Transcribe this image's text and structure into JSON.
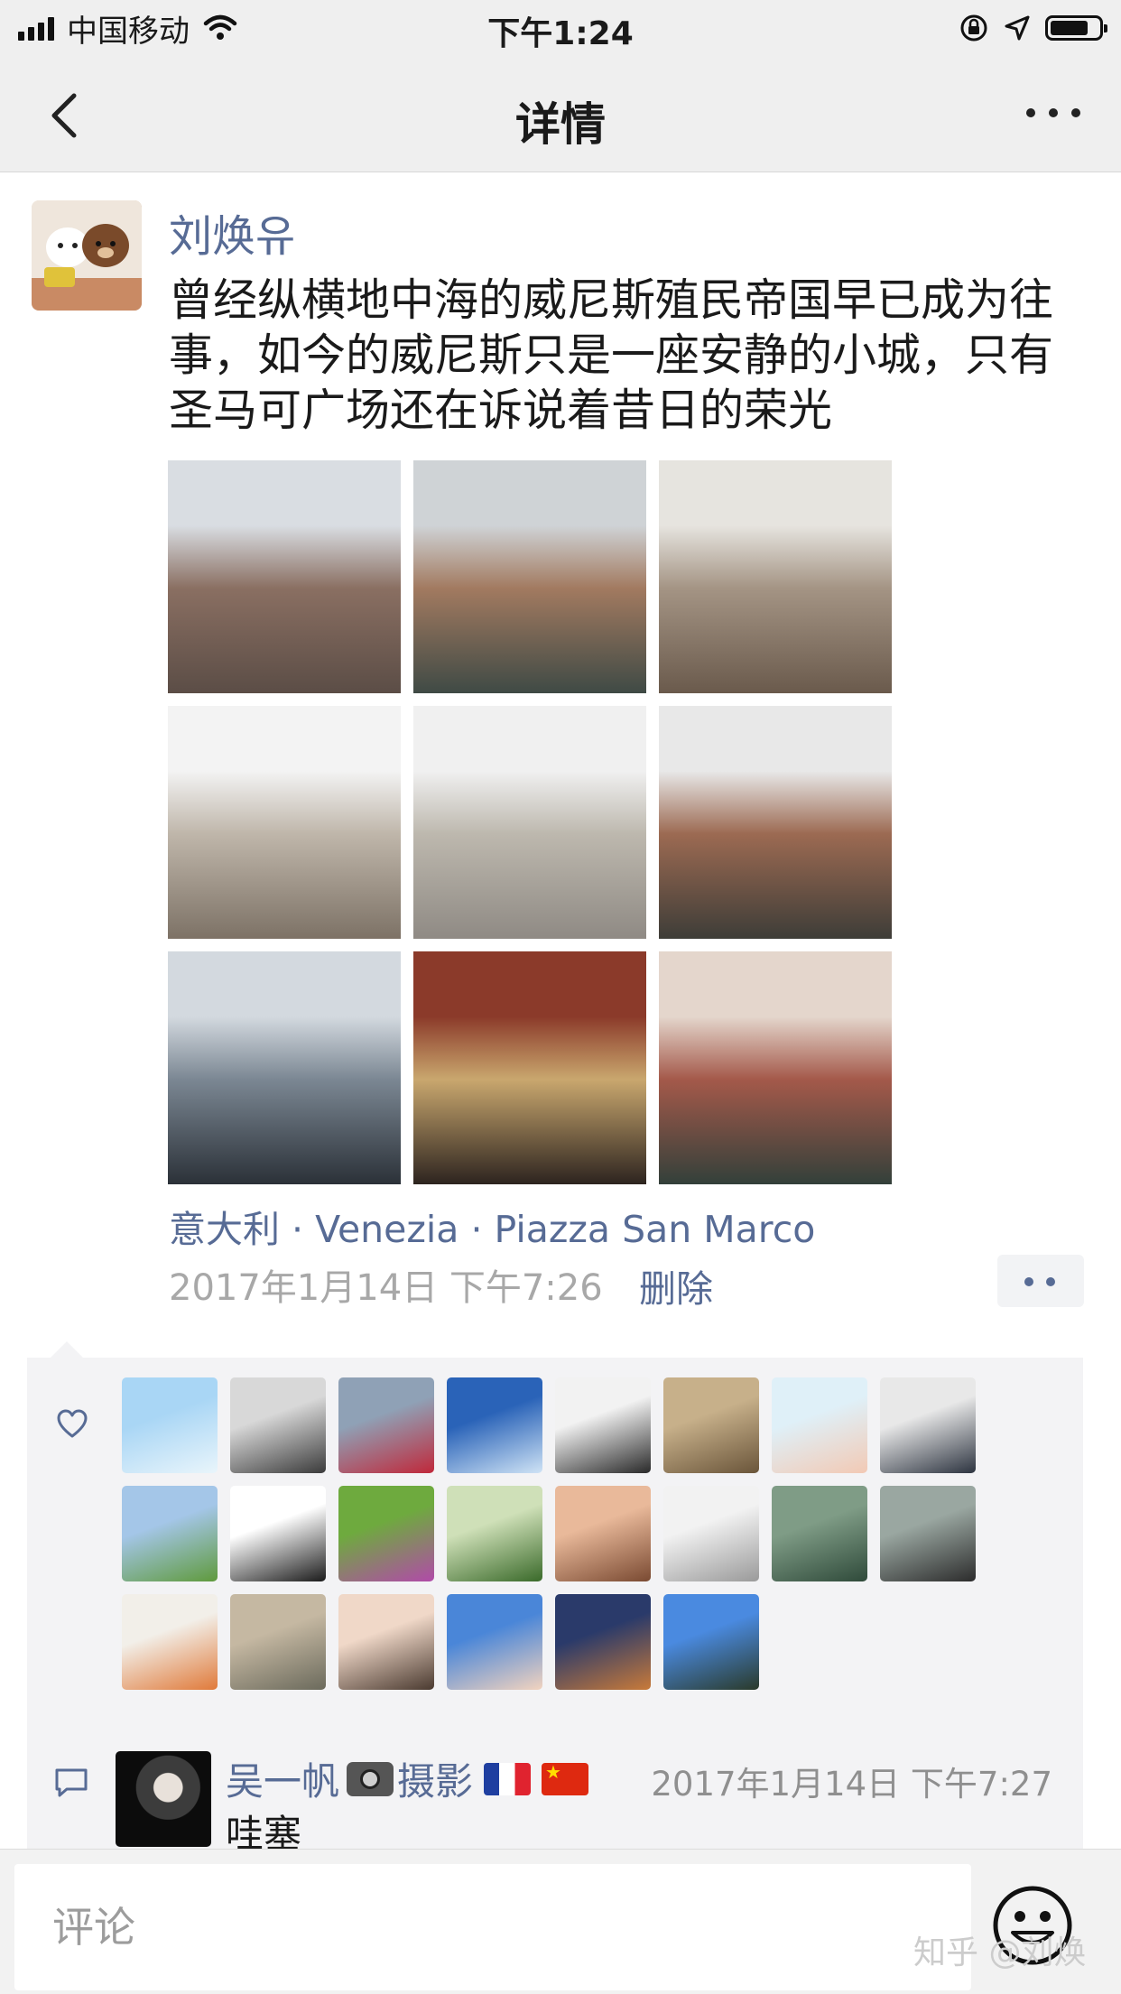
{
  "status_bar": {
    "carrier": "中国移动",
    "time": "下午1:24"
  },
  "nav": {
    "title": "详情"
  },
  "post": {
    "author": "刘焕유",
    "content": "曾经纵横地中海的威尼斯殖民帝国早已成为往事，如今的威尼斯只是一座安静的小城，只有圣马可广场还在诉说着昔日的荣光",
    "location": "意大利 · Venezia · Piazza San Marco",
    "timestamp": "2017年1月14日 下午7:26",
    "delete_label": "删除",
    "photos": [
      {
        "name": "venice-street-photo",
        "colors": [
          "#d9dde2",
          "#8a6f62",
          "#5b4d46"
        ]
      },
      {
        "name": "bridge-of-sighs-photo",
        "colors": [
          "#cfd3d6",
          "#a27a60",
          "#3f4a45"
        ]
      },
      {
        "name": "st-marks-basilica-photo",
        "colors": [
          "#e6e4df",
          "#a49484",
          "#6a5a4c"
        ]
      },
      {
        "name": "clock-tower-photo",
        "colors": [
          "#f3f3f3",
          "#bfb6aa",
          "#7d7266"
        ]
      },
      {
        "name": "piazza-arcade-photo",
        "colors": [
          "#f0f0f0",
          "#bdb8ae",
          "#8f8a84"
        ]
      },
      {
        "name": "canal-bridge-portrait-photo",
        "colors": [
          "#e8e8e8",
          "#9c6a52",
          "#3e3d38"
        ]
      },
      {
        "name": "gondolas-photo",
        "colors": [
          "#d3d9df",
          "#7b8793",
          "#2b3138"
        ]
      },
      {
        "name": "souvenir-shop-photo",
        "colors": [
          "#8b3a2a",
          "#c9a76e",
          "#2d241f"
        ]
      },
      {
        "name": "narrow-canal-photo",
        "colors": [
          "#e4d6cc",
          "#a4594a",
          "#33403a"
        ]
      }
    ]
  },
  "likes": {
    "likers": [
      {
        "name": "liker-dandelion-avatar",
        "colors": [
          "#a9d6f5",
          "#e9f5fb"
        ]
      },
      {
        "name": "liker-man-bw-avatar",
        "colors": [
          "#d8d8d8",
          "#3b3b3b"
        ]
      },
      {
        "name": "liker-red-car-avatar",
        "colors": [
          "#8fa1b6",
          "#c0283a"
        ]
      },
      {
        "name": "liker-mountain-lake-avatar",
        "colors": [
          "#2a63b8",
          "#cfe3f5"
        ]
      },
      {
        "name": "liker-sunglasses-avatar",
        "colors": [
          "#f2f2f2",
          "#2a2a2a"
        ]
      },
      {
        "name": "liker-painting-avatar",
        "colors": [
          "#c7b08a",
          "#6a553a"
        ]
      },
      {
        "name": "liker-cartoon-girl-avatar",
        "colors": [
          "#dff0f8",
          "#f2c9b4"
        ]
      },
      {
        "name": "liker-suit-man-avatar",
        "colors": [
          "#e8e8e8",
          "#2d3440"
        ]
      },
      {
        "name": "liker-balloons-avatar",
        "colors": [
          "#a4c6e8",
          "#5f9a3c"
        ]
      },
      {
        "name": "liker-helo-astronaut-avatar",
        "colors": [
          "#ffffff",
          "#1b1b1b"
        ]
      },
      {
        "name": "liker-thistle-flower-avatar",
        "colors": [
          "#6eaa3e",
          "#b14aa9"
        ]
      },
      {
        "name": "liker-garden-selfie-avatar",
        "colors": [
          "#cfe0b8",
          "#3a6a2a"
        ]
      },
      {
        "name": "liker-baby-avatar",
        "colors": [
          "#e9b99a",
          "#7a4a32"
        ]
      },
      {
        "name": "liker-white-wall-avatar",
        "colors": [
          "#f2f2f2",
          "#9a9a9a"
        ]
      },
      {
        "name": "liker-forest-avatar",
        "colors": [
          "#7f9c86",
          "#2f4a3a"
        ]
      },
      {
        "name": "liker-statue-avatar",
        "colors": [
          "#9aa7a1",
          "#2c2c2c"
        ]
      },
      {
        "name": "liker-flowers-avatar",
        "colors": [
          "#f2efe9",
          "#e07a3a"
        ]
      },
      {
        "name": "liker-sand-art-avatar",
        "colors": [
          "#c5b8a2",
          "#6b6a5c"
        ]
      },
      {
        "name": "liker-child-avatar",
        "colors": [
          "#f0d8c8",
          "#4a3a30"
        ]
      },
      {
        "name": "liker-boy-blue-avatar",
        "colors": [
          "#4a86d8",
          "#f2d3bf"
        ]
      },
      {
        "name": "liker-food-avatar",
        "colors": [
          "#2a3a6a",
          "#c87a3a"
        ]
      },
      {
        "name": "liker-pine-tree-avatar",
        "colors": [
          "#4a8ae0",
          "#2a3a2a"
        ]
      }
    ]
  },
  "comment": {
    "name": "吴一帆",
    "name_suffix": "摄影",
    "time": "2017年1月14日 下午7:27",
    "text": "哇塞"
  },
  "input": {
    "placeholder": "评论"
  },
  "watermark": "知乎 @刘焕",
  "colors": {
    "link": "#576b95",
    "background": "#efefef",
    "panel": "#f3f3f5"
  }
}
